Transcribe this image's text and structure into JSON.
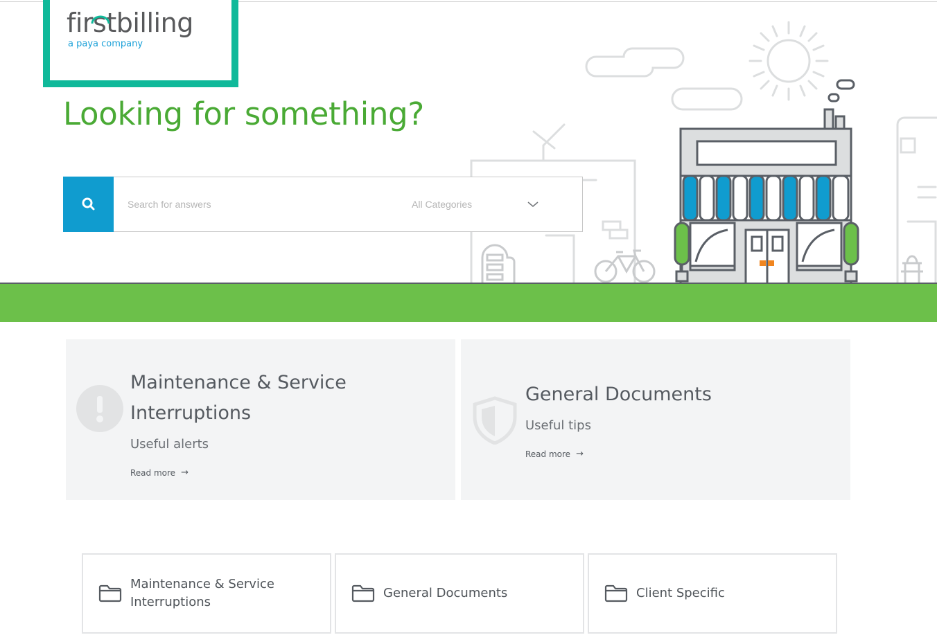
{
  "brand": {
    "logo_text": "firstbilling",
    "tagline": "a paya company",
    "accent_color": "#10b99a"
  },
  "hero": {
    "headline": "Looking for something?",
    "headline_color": "#4aaa35",
    "ground_color": "#6cc04a"
  },
  "search": {
    "placeholder": "Search for answers",
    "category_label": "All Categories",
    "button_color": "#109ccf",
    "icons": [
      "search-icon",
      "chevron-down-icon"
    ]
  },
  "features": [
    {
      "icon": "alert-icon",
      "title_line1": "Maintenance & Service",
      "title_line2": "Interruptions",
      "subtitle": "Useful alerts",
      "link": "Read more",
      "link_arrow": "→"
    },
    {
      "icon": "shield-icon",
      "title": "General Documents",
      "subtitle": "Useful tips",
      "link": "Read more",
      "link_arrow": "→"
    }
  ],
  "categories": [
    {
      "icon": "folder-icon",
      "label_line1": "Maintenance & Service",
      "label_line2": "Interruptions"
    },
    {
      "icon": "folder-icon",
      "label": "General Documents"
    },
    {
      "icon": "folder-icon",
      "label": "Client Specific"
    }
  ]
}
